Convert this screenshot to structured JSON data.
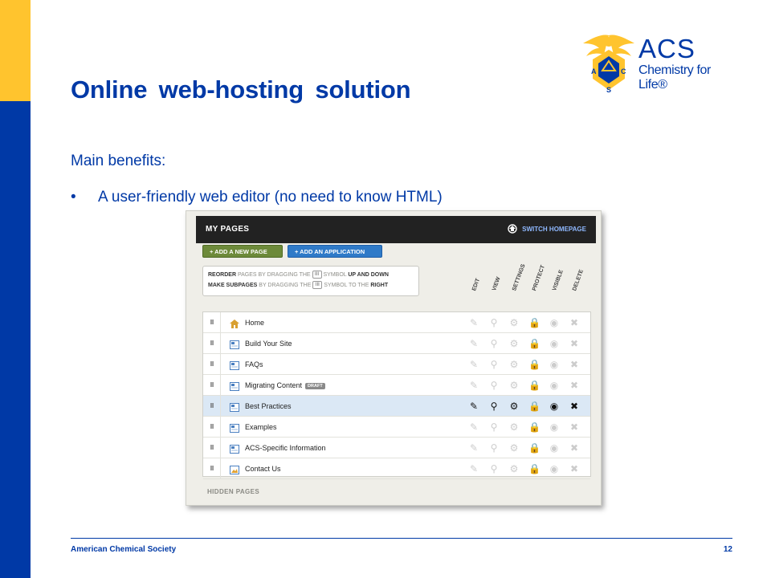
{
  "slide": {
    "title": "Online web-hosting solution",
    "benefits_heading": "Main benefits:",
    "bullet_marker": "•",
    "bullet_1": "A user-friendly web editor (no need to know HTML)"
  },
  "logo": {
    "wordmark": "ACS",
    "tagline": "Chemistry for Life®",
    "seal_letters": [
      "A",
      "C",
      "S"
    ]
  },
  "footer": {
    "organization": "American Chemical Society",
    "page_number": "12"
  },
  "colors": {
    "brand_blue": "#0039A6",
    "brand_yellow": "#FFC42E"
  },
  "screenshot": {
    "header_title": "MY PAGES",
    "switch_homepage": "SWITCH HOMEPAGE",
    "add_page_button": "+ ADD A NEW PAGE",
    "add_application_button": "+ ADD AN APPLICATION",
    "instructions": {
      "line1": {
        "a": "REORDER",
        "b": " PAGES BY DRAGGING THE ",
        "symbol": "III",
        "c": " SYMBOL ",
        "d": "UP AND DOWN"
      },
      "line2": {
        "a": "MAKE SUBPAGES",
        "b": " BY DRAGGING THE ",
        "symbol": "III",
        "c": " SYMBOL TO THE ",
        "d": "RIGHT"
      }
    },
    "columns": [
      "EDIT",
      "VIEW",
      "SETTINGS",
      "PROTECT",
      "VISIBLE",
      "DELETE"
    ],
    "grip_symbol": "III",
    "rows": [
      {
        "name": "Home",
        "icon": "home-icon",
        "badge": "",
        "active": false
      },
      {
        "name": "Build Your Site",
        "icon": "page-icon",
        "badge": "",
        "active": false
      },
      {
        "name": "FAQs",
        "icon": "page-icon",
        "badge": "",
        "active": false
      },
      {
        "name": "Migrating Content",
        "icon": "page-icon",
        "badge": "DRAFT",
        "active": false
      },
      {
        "name": "Best Practices",
        "icon": "page-icon",
        "badge": "",
        "active": true
      },
      {
        "name": "Examples",
        "icon": "page-icon",
        "badge": "",
        "active": false
      },
      {
        "name": "ACS-Specific Information",
        "icon": "page-icon",
        "badge": "",
        "active": false
      },
      {
        "name": "Contact Us",
        "icon": "image-page-icon",
        "badge": "",
        "active": false
      }
    ],
    "hidden_pages_label": "HIDDEN PAGES"
  }
}
